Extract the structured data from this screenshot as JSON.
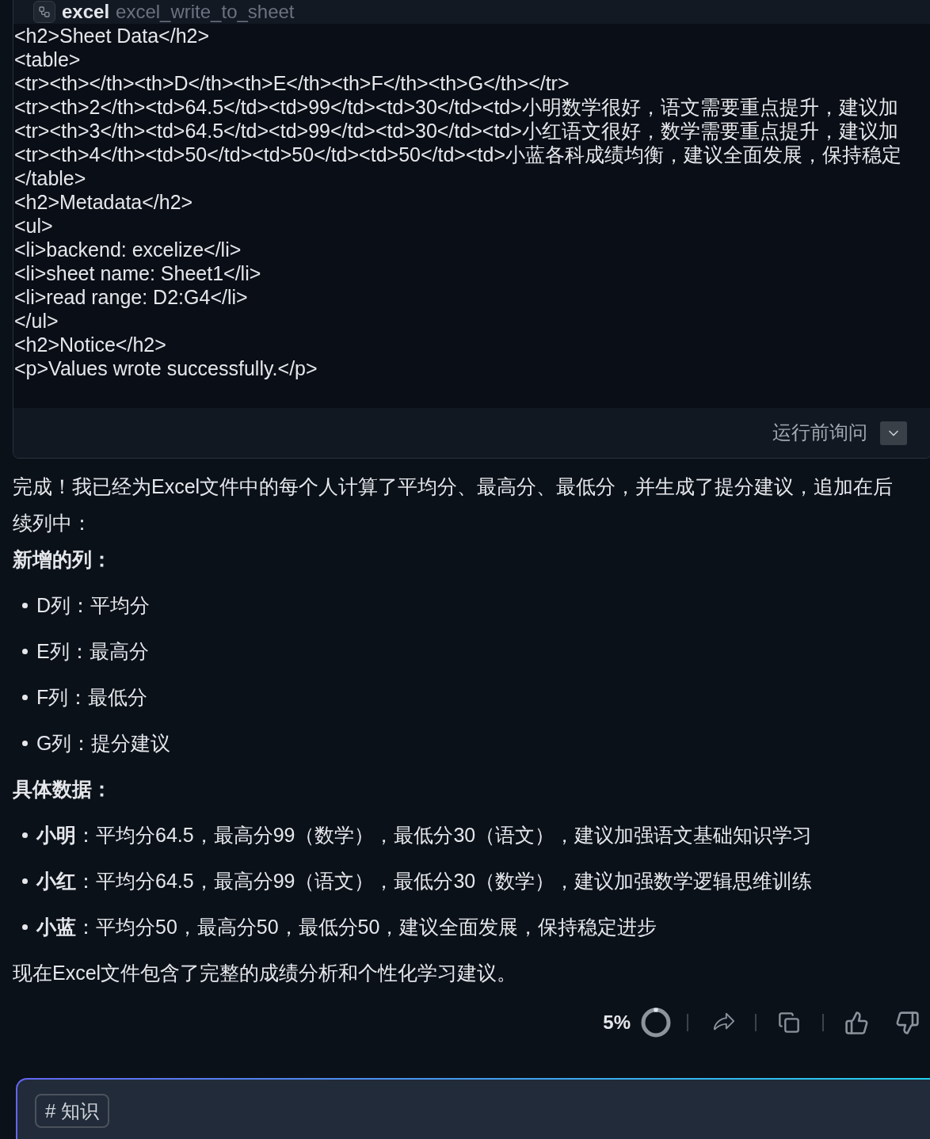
{
  "tool_call": {
    "server": "excel",
    "tool": "excel_write_to_sheet",
    "output_lines": [
      "<h2>Sheet Data</h2>",
      "<table>",
      "<tr><th></th><th>D</th><th>E</th><th>F</th><th>G</th></tr>",
      "<tr><th>2</th><td>64.5</td><td>99</td><td>30</td><td>小明数学很好，语文需要重点提升，建议加",
      "<tr><th>3</th><td>64.5</td><td>99</td><td>30</td><td>小红语文很好，数学需要重点提升，建议加",
      "<tr><th>4</th><td>50</td><td>50</td><td>50</td><td>小蓝各科成绩均衡，建议全面发展，保持稳定",
      "</table>",
      "<h2>Metadata</h2>",
      "<ul>",
      "<li>backend: excelize</li>",
      "<li>sheet name: Sheet1</li>",
      "<li>read range: D2:G4</li>",
      "</ul>",
      "<h2>Notice</h2>",
      "<p>Values wrote successfully.</p>"
    ],
    "approval_mode": "运行前询问"
  },
  "reply": {
    "blocks": [
      {
        "kind": "paragraph",
        "text": "完成！我已经为Excel文件中的每个人计算了平均分、最高分、最低分，并生成了提分建议，追加在后续列中："
      },
      {
        "kind": "heading",
        "text": "新增的列："
      },
      {
        "kind": "list",
        "items": [
          "D列：平均分",
          "E列：最高分",
          "F列：最低分",
          "G列：提分建议"
        ]
      },
      {
        "kind": "heading",
        "text": "具体数据："
      },
      {
        "kind": "list",
        "items": [
          "**小明**：平均分64.5，最高分99（数学），最低分30（语文），建议加强语文基础知识学习",
          "**小红**：平均分64.5，最高分99（语文），最低分30（数学），建议加强数学逻辑思维训练",
          "**小蓝**：平均分50，最高分50，最低分50，建议全面发展，保持稳定进步"
        ]
      },
      {
        "kind": "paragraph",
        "text": "现在Excel文件包含了完整的成绩分析和个性化学习建议。"
      }
    ]
  },
  "message_actions": {
    "usage": {
      "reading": "5%",
      "level": 0.05
    }
  },
  "composer": {
    "tags": [
      "# 知识"
    ]
  }
}
